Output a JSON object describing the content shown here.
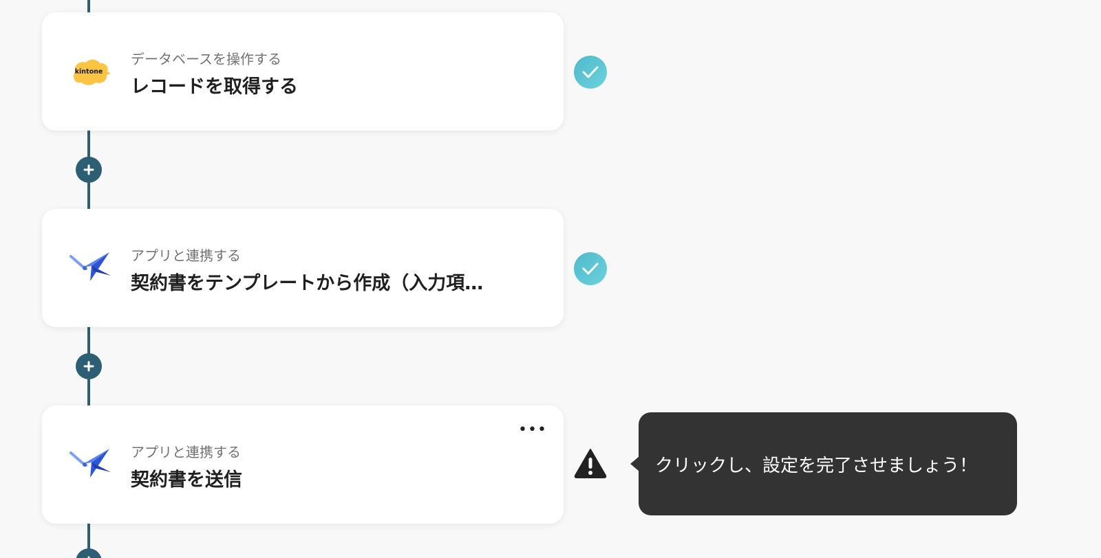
{
  "steps": [
    {
      "app_icon": "kintone-icon",
      "app_icon_text": "kintone",
      "subtitle": "データベースを操作する",
      "title": "レコードを取得する",
      "status": "complete"
    },
    {
      "app_icon": "cloudsign-icon",
      "subtitle": "アプリと連携する",
      "title": "契約書をテンプレートから作成（入力項…",
      "status": "complete"
    },
    {
      "app_icon": "cloudsign-icon",
      "subtitle": "アプリと連携する",
      "title": "契約書を送信",
      "status": "warning",
      "more_label": "•••"
    }
  ],
  "tooltip": {
    "text": "クリックし、設定を完了させましょう！"
  },
  "colors": {
    "connector": "#2c5f74",
    "check_gradient_start": "#5cc9dd",
    "check_gradient_end": "#4fb9cc",
    "warning": "#222222",
    "tooltip_bg": "#333333",
    "kintone_yellow": "#fbc443"
  }
}
